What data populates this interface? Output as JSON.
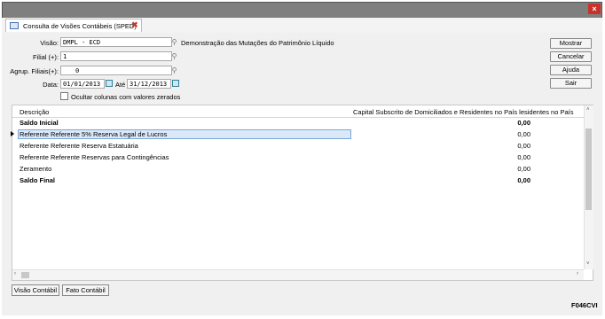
{
  "window": {
    "close_glyph": "×"
  },
  "tab": {
    "label": "Consulta de Visões Contábeis (SPED)",
    "close_glyph": "✖",
    "icon": "window-icon"
  },
  "form": {
    "visao_label": "Visão:",
    "visao_value": "DMPL - ECD",
    "visao_desc": "Demonstração das Mutações do Patrimônio Líquido",
    "filial_label": "Filial (+):",
    "filial_value": "1",
    "agrup_label": "Agrup. Filiais(+):",
    "agrup_value": "0",
    "data_label": "Data:",
    "data_inicio": "01/01/2013",
    "ate_label": "Até",
    "data_fim": "31/12/2013",
    "ocultar_label": "Ocultar colunas com valores zerados"
  },
  "buttons": {
    "mostrar": "Mostrar",
    "cancelar": "Cancelar",
    "ajuda": "Ajuda",
    "sair": "Sair"
  },
  "grid": {
    "header_desc": "Descrição",
    "header_col": "Capital Subscrito de Domiciliados e Residentes no País lesidentes no País",
    "rows": [
      {
        "desc": "Saldo Inicial",
        "value": "0,00",
        "bold": true
      },
      {
        "desc": "Referente Referente 5% Reserva Legal de Lucros",
        "value": "0,00",
        "bold": false,
        "selected": true
      },
      {
        "desc": "Referente Referente Reserva Estatuária",
        "value": "0,00",
        "bold": false
      },
      {
        "desc": "Referente Referente Reservas para Contingências",
        "value": "0,00",
        "bold": false
      },
      {
        "desc": "Zeramento",
        "value": "0,00",
        "bold": false
      },
      {
        "desc": "Saldo Final",
        "value": "0,00",
        "bold": true
      }
    ]
  },
  "footer": {
    "visao_contabil": "Visão Contábil",
    "fato_contabil": "Fato Contábil",
    "code": "F046CVI"
  }
}
